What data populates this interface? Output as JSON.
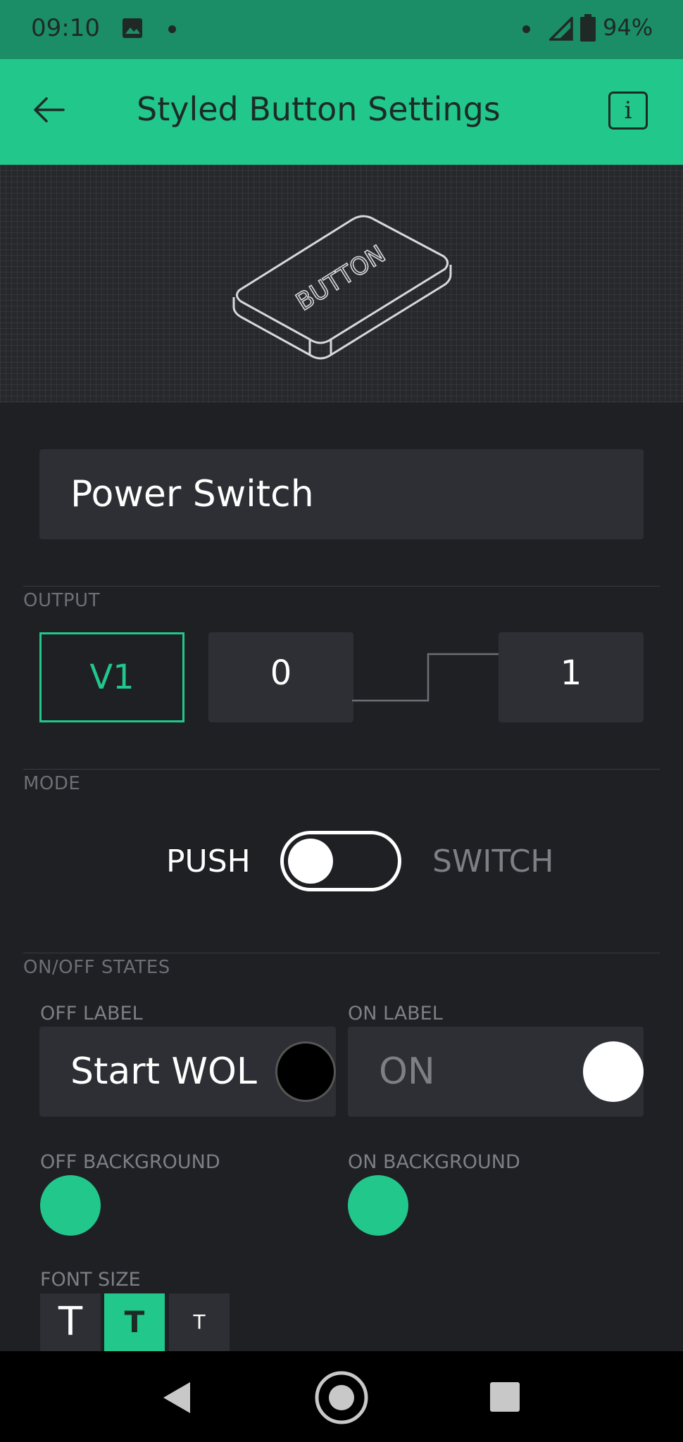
{
  "status_bar": {
    "time": "09:10",
    "battery": "94%"
  },
  "app_bar": {
    "title": "Styled Button Settings",
    "info_icon": "i"
  },
  "preview": {
    "button_text": "BUTTON"
  },
  "name_field": {
    "value": "Power Switch"
  },
  "output": {
    "section_label": "OUTPUT",
    "pin": "V1",
    "low_value": "0",
    "high_value": "1"
  },
  "mode": {
    "section_label": "MODE",
    "push_label": "PUSH",
    "switch_label": "SWITCH",
    "selected": "PUSH"
  },
  "states": {
    "section_label": "ON/OFF STATES",
    "off_label_title": "OFF LABEL",
    "off_label_value": "Start WOL",
    "off_label_color": "#000000",
    "on_label_title": "ON LABEL",
    "on_label_value": "ON",
    "on_label_color": "#ffffff",
    "off_background_title": "OFF BACKGROUND",
    "off_background_color": "#22c78c",
    "on_background_title": "ON BACKGROUND",
    "on_background_color": "#22c78c"
  },
  "font_size": {
    "title": "FONT SIZE",
    "options": [
      "T",
      "T",
      "T"
    ],
    "selected_index": 1
  },
  "colors": {
    "accent": "#22c78c",
    "background": "#1f2024",
    "field": "#2e2f34"
  }
}
